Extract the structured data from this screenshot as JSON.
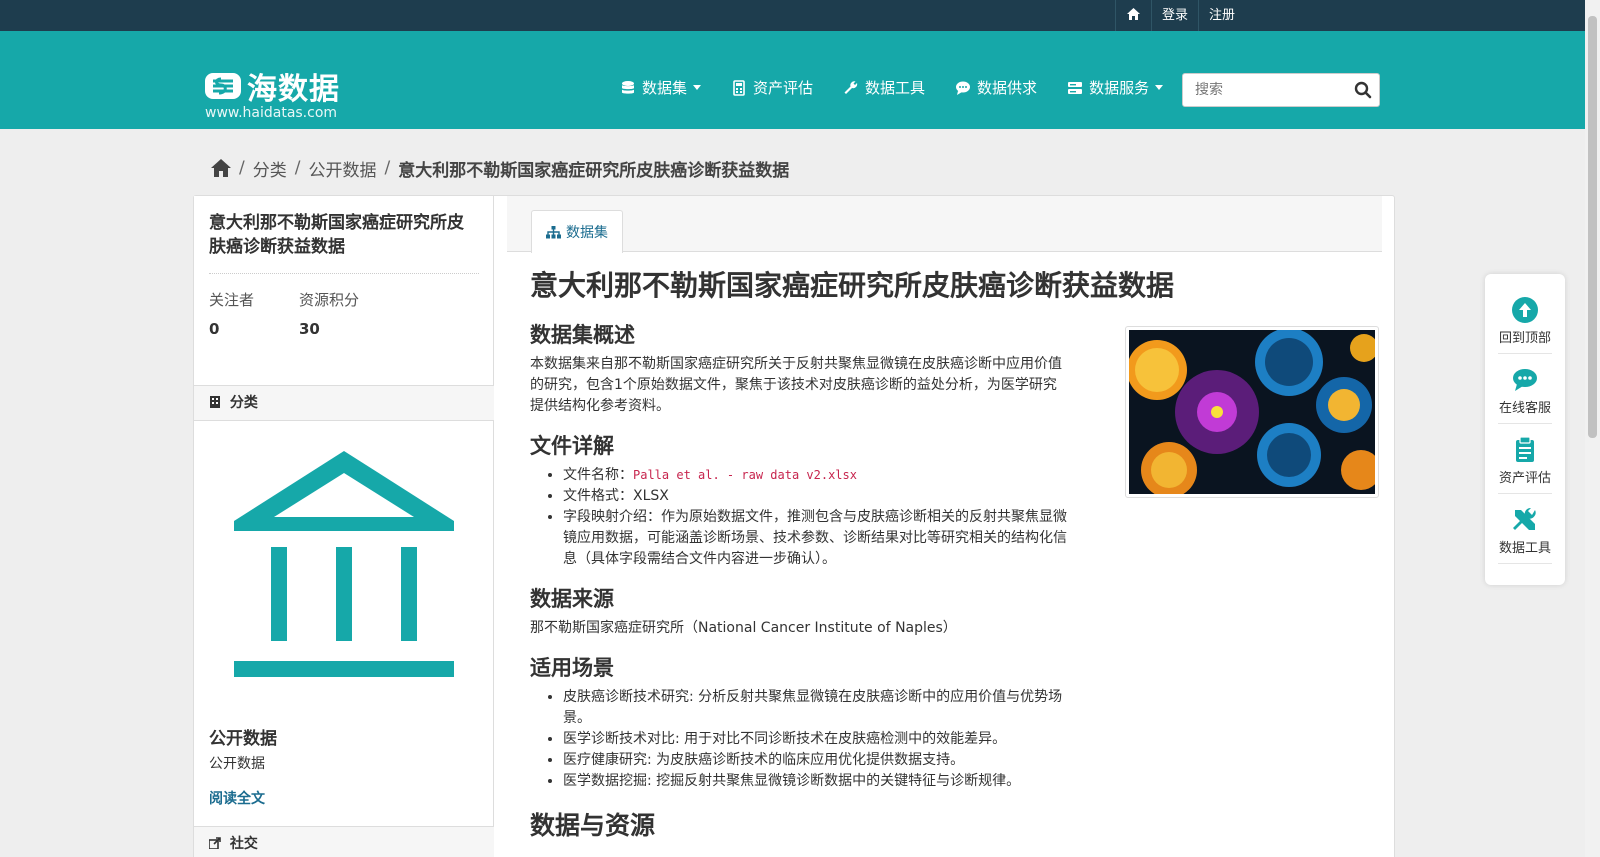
{
  "topbar": {
    "login": "登录",
    "register": "注册"
  },
  "brand": {
    "name": "海数据",
    "url": "www.haidatas.com"
  },
  "nav": {
    "items": [
      {
        "label": "数据集",
        "icon": "database-icon",
        "dropdown": true
      },
      {
        "label": "资产评估",
        "icon": "calculator-icon",
        "dropdown": false
      },
      {
        "label": "数据工具",
        "icon": "wrench-icon",
        "dropdown": false
      },
      {
        "label": "数据供求",
        "icon": "chat-icon",
        "dropdown": false
      },
      {
        "label": "数据服务",
        "icon": "server-icon",
        "dropdown": true
      }
    ]
  },
  "search": {
    "placeholder": "搜索"
  },
  "breadcrumb": {
    "categories": "分类",
    "public": "公开数据",
    "current": "意大利那不勒斯国家癌症研究所皮肤癌诊断获益数据"
  },
  "sidebar": {
    "title": "意大利那不勒斯国家癌症研究所皮肤癌诊断获益数据",
    "followers_label": "关注者",
    "followers": "0",
    "points_label": "资源积分",
    "points": "30",
    "category_header": "分类",
    "org_name": "公开数据",
    "org_desc": "公开数据",
    "read_more": "阅读全文",
    "social_header": "社交"
  },
  "tab": {
    "label": "数据集"
  },
  "dataset": {
    "title": "意大利那不勒斯国家癌症研究所皮肤癌诊断获益数据",
    "overview_heading": "数据集概述",
    "overview": "本数据集来自那不勒斯国家癌症研究所关于反射共聚焦显微镜在皮肤癌诊断中应用价值的研究，包含1个原始数据文件，聚焦于该技术对皮肤癌诊断的益处分析，为医学研究提供结构化参考资料。",
    "file_heading": "文件详解",
    "file_name_label": "文件名称：",
    "file_name": "Palla et al. - raw data v2.xlsx",
    "file_format": "文件格式：XLSX",
    "field_mapping": "字段映射介绍：作为原始数据文件，推测包含与皮肤癌诊断相关的反射共聚焦显微镜应用数据，可能涵盖诊断场景、技术参数、诊断结果对比等研究相关的结构化信息（具体字段需结合文件内容进一步确认）。",
    "source_heading": "数据来源",
    "source": "那不勒斯国家癌症研究所（National Cancer Institute of Naples）",
    "usage_heading": "适用场景",
    "usage": [
      "皮肤癌诊断技术研究: 分析反射共聚焦显微镜在皮肤癌诊断中的应用价值与优势场景。",
      "医学诊断技术对比: 用于对比不同诊断技术在皮肤癌检测中的效能差异。",
      "医疗健康研究: 为皮肤癌诊断技术的临床应用优化提供数据支持。",
      "医学数据挖掘: 挖掘反射共聚焦显微镜诊断数据中的关键特征与诊断规律。"
    ],
    "resources_heading": "数据与资源"
  },
  "float_panel": [
    {
      "label": "回到顶部",
      "icon": "arrow-up-circle-icon"
    },
    {
      "label": "在线客服",
      "icon": "chat-bubble-icon"
    },
    {
      "label": "资产评估",
      "icon": "clipboard-icon"
    },
    {
      "label": "数据工具",
      "icon": "tools-icon"
    }
  ],
  "colors": {
    "teal": "#16a8a9",
    "topbar": "#1e3d4e",
    "link": "#1b6c8f"
  }
}
